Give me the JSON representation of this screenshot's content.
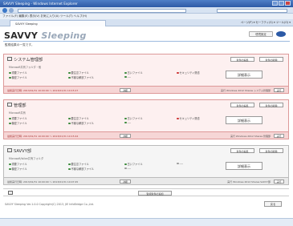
{
  "window": {
    "title": "SAVVY Sleeping - Windows Internet Explorer"
  },
  "browser": {
    "menu": [
      "ファイル(F)",
      "編集(E)",
      "表示(V)",
      "お気に入り(A)",
      "ツール(T)",
      "ヘルプ(H)"
    ],
    "tab_title": "SAVVY Sleeping",
    "tools": "ページ(P) ▾  セーフティ(S) ▾  ツール(O) ▾"
  },
  "app": {
    "logo_main": "SAVVY",
    "logo_script": "Sleeping",
    "top_btn_1": "環境設定",
    "page_subtitle": "監視結果の一覧です。"
  },
  "cards": [
    {
      "title": "システム管理部",
      "subtitle": "Microsoft共有フォルダ・他",
      "style": "red",
      "btn_left": "条件の編集",
      "btn_right": "条件の削除",
      "stats": [
        "重要ファイル",
        "機密ファイル",
        "要注意ファイル",
        "不審な解放ファイル",
        "古いファイル",
        "----",
        "セキュリティ懸念"
      ],
      "big_button": "詳細表示",
      "last_run": "最終実行日時: 2013/01/31 10:00:00 ～ 2013/01/31 10:15:27",
      "last_run_btn": "詳細",
      "footer_right": "実行 Windows 2012 Shares システム管理部",
      "footer_btn": "実行"
    },
    {
      "title": "管理部",
      "subtitle": "Microsoft共有",
      "style": "red",
      "btn_left": "条件の編集",
      "btn_right": "条件の削除",
      "stats": [
        "重要ファイル",
        "機密ファイル",
        "要注意ファイル",
        "不審な解放ファイル",
        "古いファイル",
        "----",
        "セキュリティ懸念"
      ],
      "big_button": "詳細表示",
      "last_run": "最終実行日時: 2013/01/31 10:00:00 ～ 2013/01/31 10:15:44",
      "last_run_btn": "詳細",
      "footer_right": "実行 Windows 2012 Shares 管理部",
      "footer_btn": "実行"
    },
    {
      "title": "SAVVY部",
      "subtitle": "Microsoft/Isilon共有フォルダ",
      "style": "gray",
      "btn_left": "条件の編集",
      "btn_right": "条件の削除",
      "stats": [
        "重要ファイル",
        "機密ファイル",
        "要注意ファイル",
        "不審な解放ファイル",
        "古いファイル",
        "----",
        "----"
      ],
      "big_button": "詳細表示",
      "last_run": "最終実行日時: 2013/01/31 10:00:00 ～ 2013/01/31 10:07:45",
      "last_run_btn": "詳細",
      "footer_right": "実行 Windows 2012 Shares SAVVY部",
      "footer_btn": "実行"
    }
  ],
  "footer": {
    "add_button": "監視条件の追加",
    "copyright": "SAVVY Sleeping Ver.1.0.0 Copyright(C) 2013, JIE InfoBridge Co.,Ltd.",
    "back_top": "戻る"
  },
  "colors": {
    "accent": "#2c5aa6",
    "alert_bg": "#fdf0f0",
    "alert_border": "#dd9999"
  }
}
